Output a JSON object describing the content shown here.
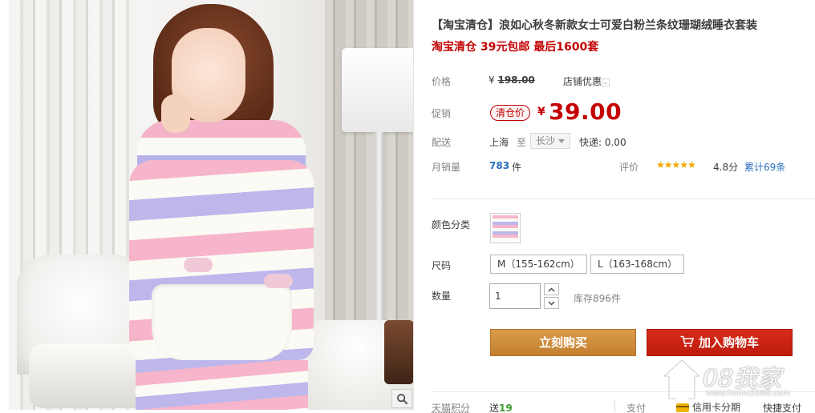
{
  "product": {
    "title": "【淘宝清仓】浪如心秋冬新款女士可爱白粉兰条纹珊瑚绒睡衣套装",
    "subtitle": "淘宝清仓 39元包邮 最后1600套"
  },
  "price": {
    "label": "价格",
    "currency": "¥",
    "original": "198.00",
    "shop_discount": "店铺优惠"
  },
  "promo": {
    "label": "促销",
    "badge": "清仓价",
    "currency": "¥",
    "price": "39.00"
  },
  "shipping": {
    "label": "配送",
    "from": "上海",
    "to_word": "至",
    "city": "长沙",
    "fee": "快递: 0.00"
  },
  "sales": {
    "label": "月销量",
    "count": "783",
    "unit": "件",
    "rating_label": "评价",
    "stars": "★★★★★",
    "score": "4.8分",
    "total": "累计69条"
  },
  "options": {
    "color_label": "颜色分类",
    "size_label": "尺码",
    "sizes": [
      "M（155-162cm）",
      "L（163-168cm）"
    ],
    "qty_label": "数量",
    "qty_value": "1",
    "stock": "库存896件"
  },
  "actions": {
    "buy_now": "立刻购买",
    "add_cart": "加入购物车"
  },
  "footer": {
    "points_label": "天猫积分",
    "points_give_prefix": "送",
    "points_value": "19",
    "pay_label": "支付",
    "pay_card": "信用卡分期",
    "pay_quick": "快捷支付"
  },
  "watermark": {
    "text": "08我家",
    "sub": "www.home2008.com"
  },
  "colors": {
    "accent_red": "#c40000",
    "buy_orange": "#c47f30",
    "cart_red": "#be1b0d",
    "link_blue": "#2a6ebb",
    "star_gold": "#f2a500"
  }
}
